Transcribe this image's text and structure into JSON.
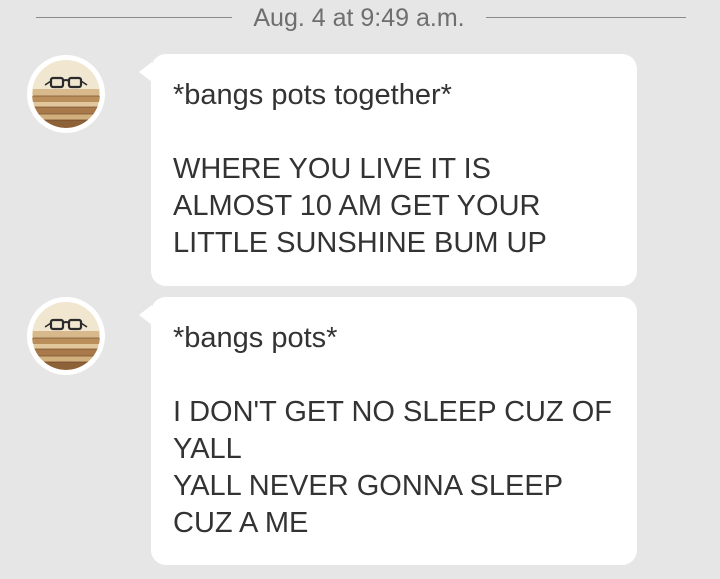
{
  "timestamp": "Aug. 4 at 9:49 a.m.",
  "messages": [
    {
      "text": "*bangs pots together*\n\nWHERE YOU LIVE IT IS\nALMOST 10 AM GET YOUR\nLITTLE SUNSHINE BUM UP",
      "avatar_icon": "books-and-glasses-icon"
    },
    {
      "text": "*bangs pots*\n\nI DON'T GET NO SLEEP CUZ OF\nYALL\nYALL NEVER GONNA SLEEP\nCUZ A ME",
      "avatar_icon": "books-and-glasses-icon"
    }
  ]
}
